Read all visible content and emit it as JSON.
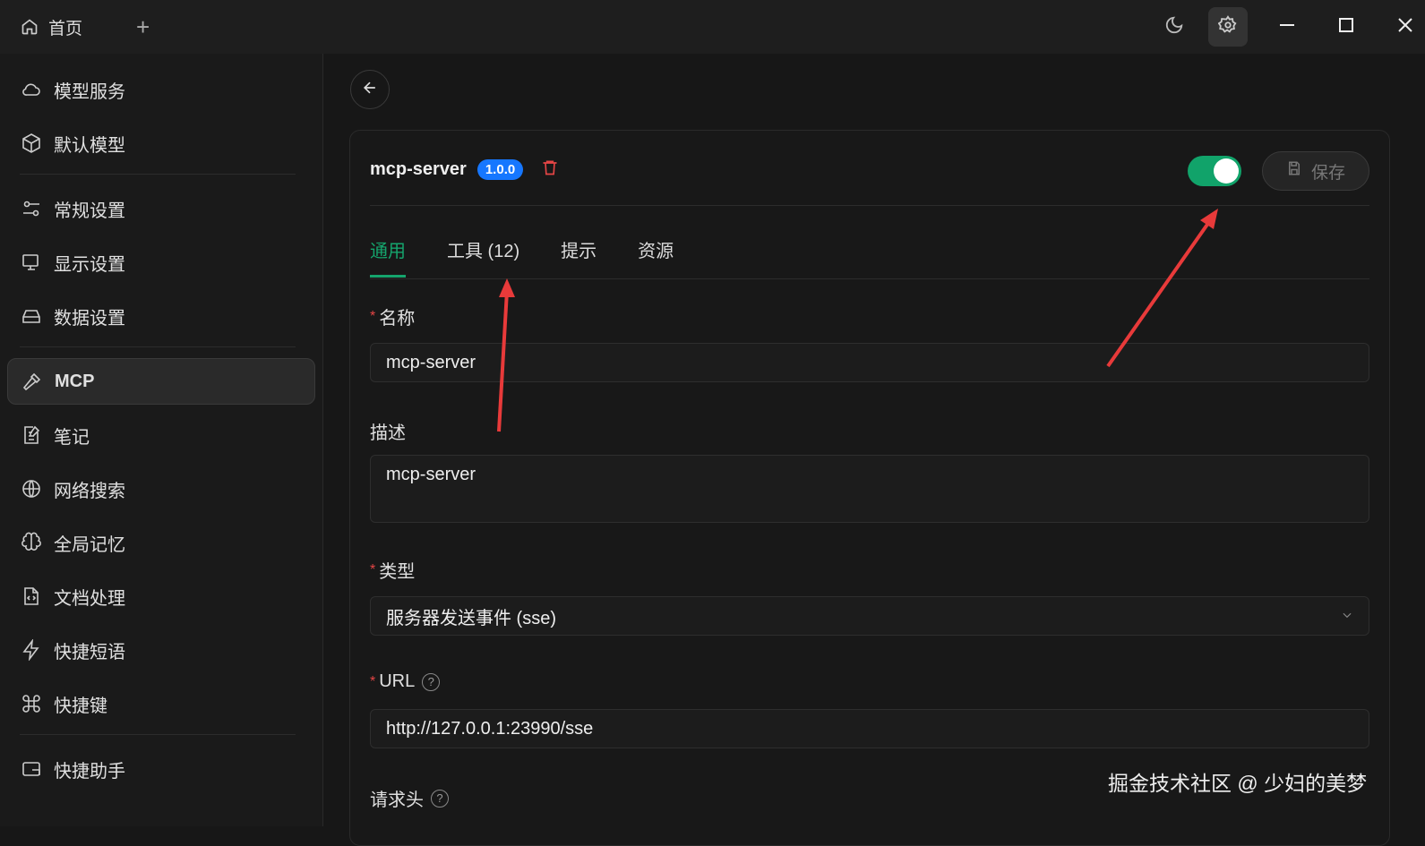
{
  "titlebar": {
    "home_label": "首页"
  },
  "sidebar": {
    "items": [
      {
        "label": "模型服务",
        "icon": "cloud-icon"
      },
      {
        "label": "默认模型",
        "icon": "cube-icon"
      },
      {
        "label": "常规设置",
        "icon": "sliders-icon"
      },
      {
        "label": "显示设置",
        "icon": "monitor-icon"
      },
      {
        "label": "数据设置",
        "icon": "hard-drive-icon"
      },
      {
        "label": "MCP",
        "icon": "hammer-icon"
      },
      {
        "label": "笔记",
        "icon": "note-icon"
      },
      {
        "label": "网络搜索",
        "icon": "globe-icon"
      },
      {
        "label": "全局记忆",
        "icon": "brain-icon"
      },
      {
        "label": "文档处理",
        "icon": "file-code-icon"
      },
      {
        "label": "快捷短语",
        "icon": "zap-icon"
      },
      {
        "label": "快捷键",
        "icon": "command-icon"
      },
      {
        "label": "快捷助手",
        "icon": "app-window-icon"
      }
    ]
  },
  "server": {
    "name": "mcp-server",
    "version": "1.0.0",
    "enabled": true,
    "save_label": "保存"
  },
  "tabs": [
    "通用",
    "工具 (12)",
    "提示",
    "资源"
  ],
  "form": {
    "name_label": "名称",
    "name_value": "mcp-server",
    "desc_label": "描述",
    "desc_value": "mcp-server",
    "type_label": "类型",
    "type_value": "服务器发送事件 (sse)",
    "url_label": "URL",
    "url_value": "http://127.0.0.1:23990/sse",
    "headers_label": "请求头"
  },
  "watermark": "掘金技术社区 @ 少妇的美梦",
  "colors": {
    "accent": "#15a56d",
    "badge": "#1677ff",
    "danger": "#e54545"
  }
}
